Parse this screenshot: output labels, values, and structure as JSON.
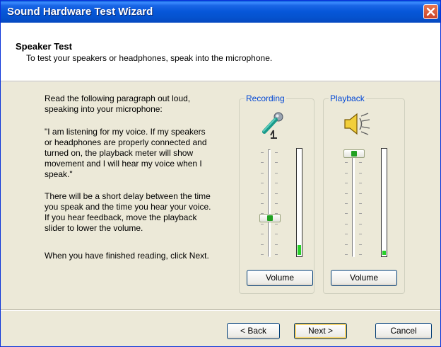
{
  "window": {
    "title": "Sound Hardware Test Wizard"
  },
  "header": {
    "title": "Speaker Test",
    "subtitle": "To test your speakers or headphones, speak into the microphone."
  },
  "instructions": {
    "p1": [
      "Read the following paragraph out loud,",
      "speaking into your microphone:"
    ],
    "p2": [
      "\"I am listening for my voice. If my speakers",
      "or headphones are properly connected and",
      "turned on, the playback meter will show",
      "movement and I will hear my voice when I",
      "speak.\""
    ],
    "p3": [
      "There will be a short delay between the time",
      "you speak and the time you hear your voice.",
      "If you hear feedback, move the playback",
      "slider to lower the volume."
    ],
    "p4": [
      "When you have finished reading, click Next."
    ]
  },
  "recording": {
    "label": "Recording",
    "volume_label": "Volume",
    "slider_level": 0.35,
    "meter_level": 0.09
  },
  "playback": {
    "label": "Playback",
    "volume_label": "Volume",
    "slider_level": 1.0,
    "meter_level": 0.04
  },
  "buttons": {
    "back": "< Back",
    "next": "Next >",
    "cancel": "Cancel"
  },
  "colors": {
    "title_bar": "#0553cf",
    "group_label": "#0046d5",
    "meter_fill": "#28d028",
    "face": "#ece9d8"
  },
  "icons": {
    "close": "close-icon",
    "microphone": "microphone-icon",
    "speaker": "speaker-icon"
  }
}
